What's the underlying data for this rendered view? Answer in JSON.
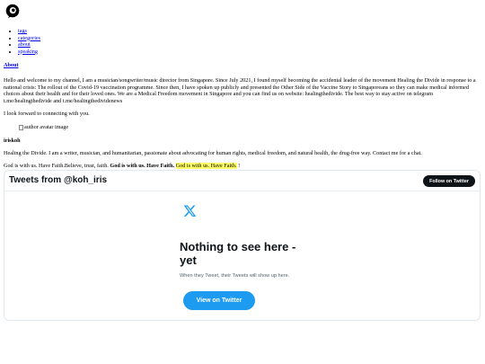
{
  "logo": {
    "icon": "brand-logo-icon"
  },
  "nav": [
    {
      "label": "tags"
    },
    {
      "label": "categories"
    },
    {
      "label": "about"
    },
    {
      "label": "speaking"
    }
  ],
  "about": {
    "heading": "About",
    "intro": "Hello and welcome to my channel, I am a musician/songwriter/music director from Singapore. Since July 2021, I found myself becoming the accidental leader of the movement Healing the Divide in response to a national crisis: The rollout of the Covid-19 vaccination programme. Since then, I have spoken up publicly and presented the Other Side of the Vaccine Story to Singaporeans so they can make medical informed choices about their health and for their loved ones. We are a Medical Freedom movement in Singapore and you can find us on website: healingthedivide. The best way to stay active on telegram t.me/healingthedivide and t.me/healingthedividenews",
    "connect": "I look forward to connecting with you.",
    "avatar_alt": "author avatar image",
    "author_name": "iriskoh",
    "bio": "Healing the Divide. I am a writer, musician, and humanitarian, passionate about advocating for human rights, medical freedom, and natural health, the drug-free way. Contact me for a chat.",
    "faith_plain": "God is with us. Have Faith.Believe, trust, faith.",
    "faith_bold": "God is with us. Have Faith.",
    "faith_highlight": "God is with us. Have Faith.",
    "faith_end": "!"
  },
  "twitter": {
    "title": "Tweets from @koh_iris",
    "follow_label": "Follow on Twitter",
    "logo_icon": "x-logo-icon",
    "empty_title": "Nothing to see here - yet",
    "empty_sub": "When they Tweet, their Tweets will show up here.",
    "view_label": "View on Twitter",
    "colors": {
      "button": "#1d9bf0",
      "follow": "#0f1419",
      "border": "#e1e8ed"
    }
  }
}
